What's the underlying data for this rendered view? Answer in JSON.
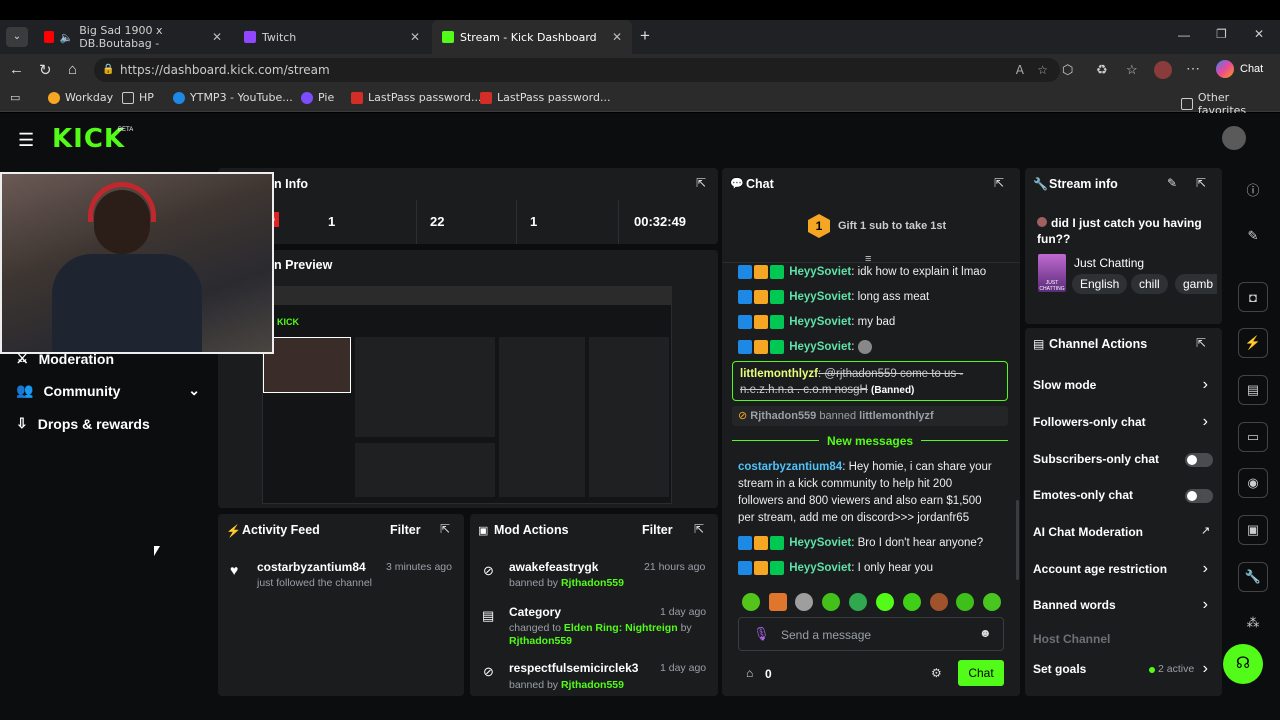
{
  "browser": {
    "tabs": [
      {
        "label": "Big Sad 1900 x DB.Boutabag - ",
        "icon_color": "#ff0000"
      },
      {
        "label": "Twitch",
        "icon_color": "#9146ff"
      },
      {
        "label": "Stream - Kick Dashboard",
        "icon_color": "#53fc18"
      }
    ],
    "url": "https://dashboard.kick.com/stream",
    "chat_button": "Chat",
    "favorites": [
      "Workday",
      "HP",
      "YTMP3 - YouTube...",
      "Pie",
      "LastPass password...",
      "LastPass password..."
    ],
    "other_favorites": "Other favorites"
  },
  "kick": {
    "logo": "KICK",
    "beta": "BETA"
  },
  "stream_info_panel": {
    "title_fragment": "n Info",
    "live_badge": "NG",
    "stats": [
      "1",
      "22",
      "1",
      "00:32:49"
    ],
    "preview_title": "n Preview"
  },
  "sidebar_nav": {
    "moderation": "Moderation",
    "community": "Community",
    "drops": "Drops & rewards"
  },
  "activity_feed": {
    "title": "Activity Feed",
    "filter": "Filter",
    "items": [
      {
        "user": "costarbyzantium84",
        "time": "3 minutes ago",
        "detail": "just followed the channel"
      }
    ]
  },
  "mod_actions": {
    "title": "Mod Actions",
    "filter": "Filter",
    "items": [
      {
        "title": "awakefeastrygk",
        "time": "21 hours ago",
        "prefix": "banned by",
        "actor": "Rjthadon559"
      },
      {
        "title": "Category",
        "time": "1 day ago",
        "prefix": "changed to",
        "value": "Elden Ring: Nightreign",
        "suffix": "by",
        "actor": "Rjthadon559"
      },
      {
        "title": "respectfulsemicirclek3",
        "time": "1 day ago",
        "prefix": "banned by",
        "actor": "Rjthadon559"
      }
    ]
  },
  "chat": {
    "title": "Chat",
    "gift_badge": "1",
    "gift_text": "Gift 1 sub to take 1st",
    "messages_top": [
      {
        "user": "HeyySoviet",
        "text": ": idk how to explain it lmao"
      },
      {
        "user": "HeyySoviet",
        "text": ": long ass meat"
      },
      {
        "user": "HeyySoviet",
        "text": ": my bad"
      },
      {
        "user": "HeyySoviet",
        "text": ":"
      }
    ],
    "banned_msg": {
      "user": "littlemonthlyzf",
      "text": ": @rjthadon559 come to us - n.e.z.h.n.a . c.o.m nosgH",
      "tag": "(Banned)"
    },
    "ban_notice": {
      "actor": "Rjthadon559",
      "verb": "banned",
      "target": "littlemonthlyzf"
    },
    "new_messages": "New messages",
    "long_msg": {
      "user": "costarbyzantium84",
      "lines": [
        ": Hey homie, i can share your",
        "stream in a kick community to help hit 200",
        "followers and 800 viewers and also earn $1,500",
        "per stream, add me on discord>>> jordanfr65"
      ]
    },
    "messages_bottom": [
      {
        "user": "HeyySoviet",
        "text": ": Bro I don't hear anyone?"
      },
      {
        "user": "HeyySoviet",
        "text": ": I only hear you"
      }
    ],
    "placeholder": "Send a message",
    "points": "0",
    "send_button": "Chat"
  },
  "stream_info": {
    "title": "Stream info",
    "stream_title": "did I just catch you having fun??",
    "category": "Just Chatting",
    "thumb_label": "JUST CHATTING",
    "tags": [
      "English",
      "chill",
      "gamb"
    ]
  },
  "channel_actions": {
    "title": "Channel Actions",
    "items": [
      {
        "label": "Slow mode",
        "control": "chevron"
      },
      {
        "label": "Followers-only chat",
        "control": "chevron"
      },
      {
        "label": "Subscribers-only chat",
        "control": "toggle"
      },
      {
        "label": "Emotes-only chat",
        "control": "toggle"
      },
      {
        "label": "AI Chat Moderation",
        "control": "external"
      },
      {
        "label": "Account age restriction",
        "control": "chevron"
      },
      {
        "label": "Banned words",
        "control": "chevron"
      }
    ],
    "host_channel": "Host Channel",
    "set_goals": "Set goals",
    "goals_active": "2 active"
  },
  "colors": {
    "kick_green": "#53fc18",
    "panel": "#1a1c1e",
    "chat_user": "#5ee2a8"
  }
}
